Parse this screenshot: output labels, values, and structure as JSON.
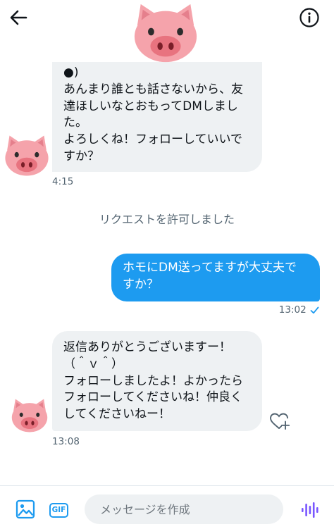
{
  "header": {
    "back_icon": "arrow-left-icon",
    "info_icon": "info-icon",
    "avatar_icon": "pig-face-icon"
  },
  "messages": [
    {
      "direction": "in",
      "text": "●)\nあんまり誰とも話さないから、友\n達ほしいなとおもってDMしまし\nた。\nよろしくね！フォローしていいで\nすか？",
      "time": "4:15"
    },
    {
      "direction": "out",
      "text": "ホモにDM送ってますが大丈夫で\nすか？",
      "time": "13:02",
      "read_icon": "checkmark-icon"
    },
    {
      "direction": "in",
      "text": "返信ありがとうございますー！\n（＾ｖ＾）\nフォローしましたよ！よかったら\nフォローしてくださいね！仲良く\nしてくださいねー！",
      "time": "13:08",
      "reaction_icon": "heart-plus-icon"
    }
  ],
  "system_notice": "リクエストを許可しました",
  "composer": {
    "image_icon": "image-icon",
    "gif_label": "GIF",
    "placeholder": "メッセージを作成",
    "value": "",
    "voice_icon": "voice-wave-icon"
  },
  "colors": {
    "accent": "#1d9bf0",
    "incoming_bubble": "#eef1f3",
    "meta_text": "#536471",
    "pig_pink": "#f5a3ab"
  }
}
